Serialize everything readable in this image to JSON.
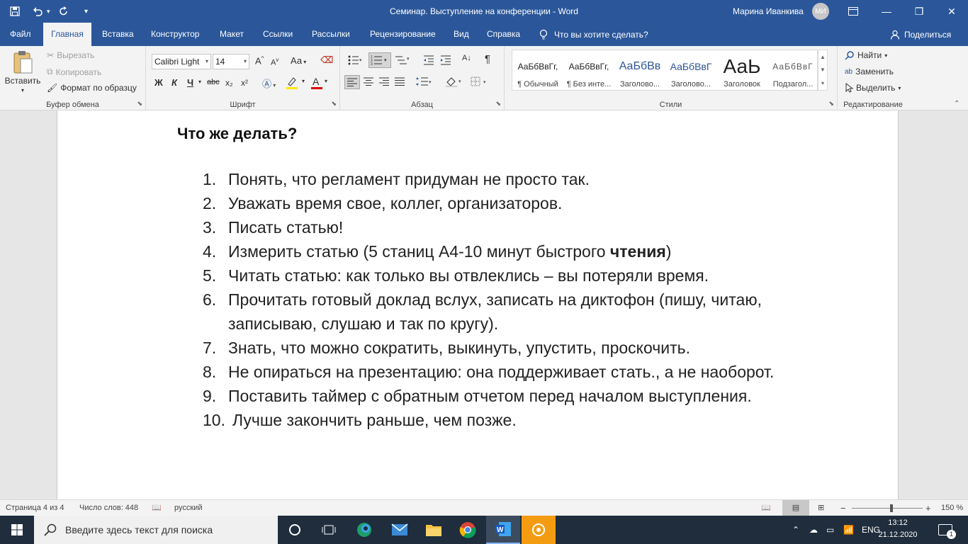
{
  "window": {
    "title": "Семинар. Выступление на конференции  -  Word",
    "user_name": "Марина Иванкива",
    "user_initials": "МИ"
  },
  "tabs": [
    {
      "label": "Файл"
    },
    {
      "label": "Главная"
    },
    {
      "label": "Вставка"
    },
    {
      "label": "Конструктор"
    },
    {
      "label": "Макет"
    },
    {
      "label": "Ссылки"
    },
    {
      "label": "Рассылки"
    },
    {
      "label": "Рецензирование"
    },
    {
      "label": "Вид"
    },
    {
      "label": "Справка"
    }
  ],
  "tell_me": "Что вы хотите сделать?",
  "share": "Поделиться",
  "clipboard": {
    "paste": "Вставить",
    "cut": "Вырезать",
    "copy": "Копировать",
    "format_painter": "Формат по образцу",
    "group": "Буфер обмена"
  },
  "font": {
    "name": "Calibri Light",
    "size": "14",
    "group": "Шрифт",
    "bold": "Ж",
    "italic": "К",
    "underline": "Ч",
    "strike": "abc",
    "subscript": "x₂",
    "superscript": "x²",
    "change_case": "Аа",
    "grow": "A",
    "shrink": "A"
  },
  "paragraph": {
    "group": "Абзац",
    "pilcrow": "¶"
  },
  "styles": {
    "group": "Стили",
    "items": [
      {
        "sample": "АаБбВвГг,",
        "name": "¶ Обычный"
      },
      {
        "sample": "АаБбВвГг,",
        "name": "¶ Без инте..."
      },
      {
        "sample": "АаБбВв",
        "name": "Заголово..."
      },
      {
        "sample": "АаБбВвГ",
        "name": "Заголово..."
      },
      {
        "sample": "АаЬ",
        "name": "Заголовок"
      },
      {
        "sample": "АаБбВвГ",
        "name": "Подзагол..."
      }
    ]
  },
  "editing": {
    "group": "Редактирование",
    "find": "Найти",
    "replace": "Заменить",
    "select": "Выделить"
  },
  "document": {
    "heading": "Что же делать?",
    "items": [
      {
        "num": "1.",
        "text": "Понять, что регламент придуман не просто так."
      },
      {
        "num": "2.",
        "text": "Уважать время свое, коллег, организаторов."
      },
      {
        "num": "3.",
        "text": "Писать статью!"
      },
      {
        "num": "4.",
        "text_before": "Измерить статью (5 станиц А4-10 минут быстрого ",
        "text_bold": "чтения",
        "text_after": ")"
      },
      {
        "num": "5.",
        "text": "Читать статью: как только вы отвлеклись – вы потеряли время."
      },
      {
        "num": "6.",
        "text": "Прочитать готовый доклад вслух, записать на диктофон (пишу, читаю, записываю, слушаю и так по кругу)."
      },
      {
        "num": "7.",
        "text": "Знать, что можно сократить, выкинуть, упустить, проскочить."
      },
      {
        "num": "8.",
        "text": "Не опираться на презентацию: она поддерживает стать., а не наоборот."
      },
      {
        "num": "9.",
        "text": "Поставить таймер с обратным отчетом перед началом выступления."
      },
      {
        "num": "10.",
        "text": "Лучше закончить раньше, чем позже."
      }
    ]
  },
  "status": {
    "page": "Страница 4 из 4",
    "words": "Число слов: 448",
    "language": "русский",
    "zoom": "150 %",
    "zoom_minus": "−",
    "zoom_plus": "+"
  },
  "taskbar": {
    "search_placeholder": "Введите здесь текст для поиска",
    "lang": "ENG",
    "time": "13:12",
    "date": "21.12.2020",
    "notifications": "1"
  }
}
